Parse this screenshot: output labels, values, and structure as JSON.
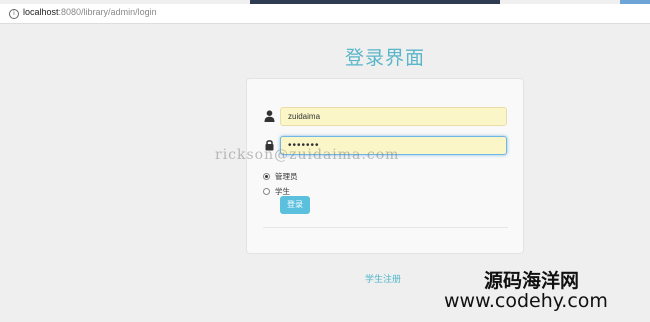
{
  "browser": {
    "info_icon": "info-icon",
    "url_host": "localhost",
    "url_rest": ":8080/library/admin/login"
  },
  "page": {
    "title": "登录界面",
    "accent_color": "#5ab6c9"
  },
  "form": {
    "username_value": "zuidaima",
    "password_value": "•••••••",
    "user_icon": "user-icon",
    "lock_icon": "lock-icon",
    "roles": [
      {
        "label": "管理员",
        "checked": true
      },
      {
        "label": "学生",
        "checked": false
      }
    ],
    "login_label": "登录"
  },
  "links": {
    "register": "学生注册"
  },
  "overlay": {
    "watermark": "rickson@zuidaima.com",
    "brand_name": "源码海洋网",
    "brand_url": "www.codehy.com"
  }
}
